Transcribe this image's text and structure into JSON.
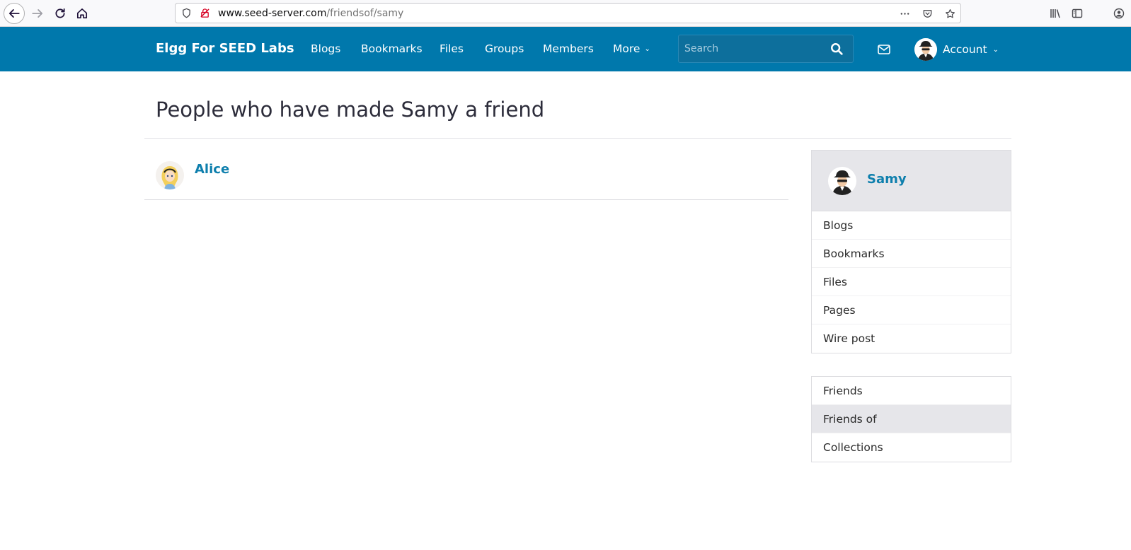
{
  "browser": {
    "url_host": "www.seed-server.com",
    "url_path": "/friendsof/samy"
  },
  "site": {
    "title": "Elgg For SEED Labs",
    "menu": [
      {
        "label": "Blogs"
      },
      {
        "label": "Bookmarks"
      },
      {
        "label": "Files"
      },
      {
        "label": "Groups"
      },
      {
        "label": "Members"
      },
      {
        "label": "More"
      }
    ],
    "search_placeholder": "Search",
    "account_label": "Account"
  },
  "main": {
    "title": "People who have made Samy a friend",
    "friends": [
      {
        "name": "Alice"
      }
    ]
  },
  "sidebar": {
    "owner_name": "Samy",
    "content_menu": [
      {
        "label": "Blogs"
      },
      {
        "label": "Bookmarks"
      },
      {
        "label": "Files"
      },
      {
        "label": "Pages"
      },
      {
        "label": "Wire post"
      }
    ],
    "friends_menu": [
      {
        "label": "Friends",
        "selected": false
      },
      {
        "label": "Friends of",
        "selected": true
      },
      {
        "label": "Collections",
        "selected": false
      }
    ]
  },
  "colors": {
    "topbar": "#0078ac",
    "link": "#0e7fad",
    "selected_bg": "#e6e6ea"
  }
}
